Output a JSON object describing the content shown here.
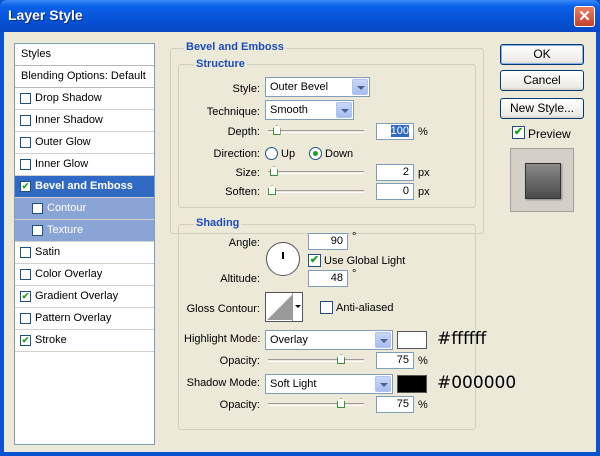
{
  "window": {
    "title": "Layer Style",
    "close_glyph": "✕"
  },
  "styles_panel": {
    "header": "Styles",
    "blending": "Blending Options: Default",
    "items": [
      {
        "label": "Drop Shadow",
        "checked": false
      },
      {
        "label": "Inner Shadow",
        "checked": false
      },
      {
        "label": "Outer Glow",
        "checked": false
      },
      {
        "label": "Inner Glow",
        "checked": false
      },
      {
        "label": "Bevel and Emboss",
        "checked": true,
        "selected": true
      },
      {
        "label": "Contour",
        "checked": false,
        "sub": true
      },
      {
        "label": "Texture",
        "checked": false,
        "sub": true
      },
      {
        "label": "Satin",
        "checked": false
      },
      {
        "label": "Color Overlay",
        "checked": false
      },
      {
        "label": "Gradient Overlay",
        "checked": true
      },
      {
        "label": "Pattern Overlay",
        "checked": false
      },
      {
        "label": "Stroke",
        "checked": true
      }
    ]
  },
  "bevel": {
    "group_title": "Bevel and Emboss",
    "structure_title": "Structure",
    "style_label": "Style:",
    "style_value": "Outer Bevel",
    "technique_label": "Technique:",
    "technique_value": "Smooth",
    "depth_label": "Depth:",
    "depth_value": "100",
    "depth_unit": "%",
    "direction_label": "Direction:",
    "direction_up": "Up",
    "direction_down": "Down",
    "direction_selected": "Down",
    "size_label": "Size:",
    "size_value": "2",
    "size_unit": "px",
    "soften_label": "Soften:",
    "soften_value": "0",
    "soften_unit": "px"
  },
  "shading": {
    "title": "Shading",
    "angle_label": "Angle:",
    "angle_value": "90",
    "angle_unit": "°",
    "global_light_label": "Use Global Light",
    "global_light_checked": true,
    "altitude_label": "Altitude:",
    "altitude_value": "48",
    "altitude_unit": "°",
    "gloss_label": "Gloss Contour:",
    "anti_aliased_label": "Anti-aliased",
    "anti_aliased_checked": false,
    "highlight_mode_label": "Highlight Mode:",
    "highlight_mode_value": "Overlay",
    "highlight_color": "#ffffff",
    "highlight_note": "#ffffff",
    "highlight_opacity_label": "Opacity:",
    "highlight_opacity_value": "75",
    "highlight_opacity_unit": "%",
    "shadow_mode_label": "Shadow Mode:",
    "shadow_mode_value": "Soft Light",
    "shadow_color": "#000000",
    "shadow_note": "#000000",
    "shadow_opacity_label": "Opacity:",
    "shadow_opacity_value": "75",
    "shadow_opacity_unit": "%"
  },
  "buttons": {
    "ok": "OK",
    "cancel": "Cancel",
    "new_style": "New Style...",
    "preview_label": "Preview",
    "preview_checked": true
  },
  "levels": {
    "depth": 0.05,
    "size": 0.02,
    "soften": 0.0,
    "highlight_opacity": 0.75,
    "shadow_opacity": 0.75
  },
  "colors": {
    "accent": "#1b4cba",
    "selected": "#316ac5",
    "check": "#21a121"
  }
}
